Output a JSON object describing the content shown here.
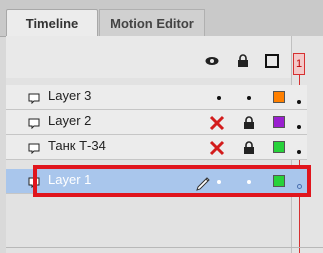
{
  "tabs": [
    {
      "label": "Timeline",
      "active": true
    },
    {
      "label": "Motion Editor",
      "active": false
    }
  ],
  "header": {
    "eye_icon": "eye-icon",
    "lock_icon": "lock-icon",
    "outline_icon": "outline-square-icon",
    "frame_number": "1"
  },
  "layers": [
    {
      "name": "Layer 3",
      "visible": true,
      "locked": false,
      "color": "#ff8000",
      "selected": false
    },
    {
      "name": "Layer 2",
      "visible": false,
      "locked": true,
      "color": "#9a1fd0",
      "selected": false
    },
    {
      "name": "Танк Т-34",
      "visible": false,
      "locked": true,
      "color": "#27d23a",
      "selected": false
    },
    {
      "name": "Layer 1",
      "visible": true,
      "locked": false,
      "color": "#27d23a",
      "selected": true,
      "editing": true
    }
  ],
  "colors": {
    "highlight": "#e0151d",
    "playhead": "#d63030",
    "selection": "#a9c6ec"
  }
}
